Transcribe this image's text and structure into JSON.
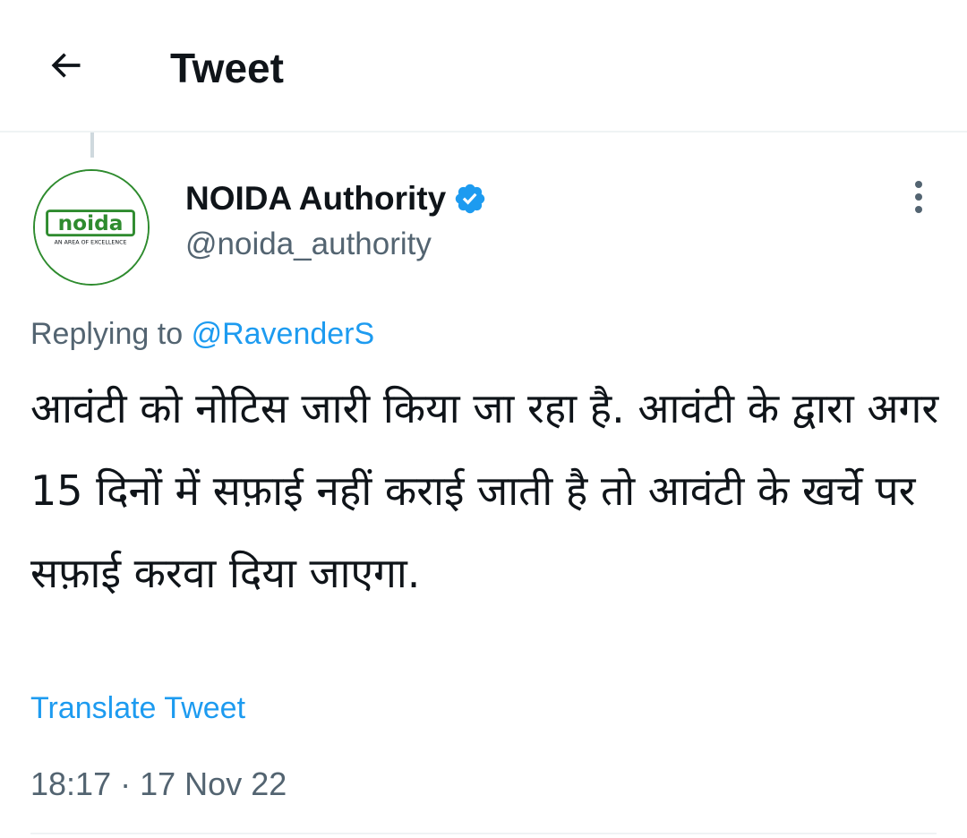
{
  "header": {
    "title": "Tweet",
    "back_icon": "arrow-left-icon"
  },
  "author": {
    "display_name": "NOIDA Authority",
    "handle": "@noida_authority",
    "verified": true,
    "verified_icon": "verified-badge-icon",
    "avatar": {
      "logo_text": "noida",
      "tagline": "AN AREA OF EXCELLENCE"
    }
  },
  "more_icon": "more-vertical-icon",
  "reply": {
    "prefix": "Replying to",
    "handle": "@RavenderS"
  },
  "tweet": {
    "text": "आवंटी को नोटिस जारी किया जा रहा है. आवंटी के द्वारा अगर 15 दिनों में सफ़ाई नहीं कराई जाती है तो आवंटी के खर्चे पर सफ़ाई करवा दिया जाएगा.",
    "translate_label": "Translate Tweet",
    "time": "18:17",
    "separator": "·",
    "date": "17 Nov 22"
  },
  "colors": {
    "accent": "#1d9bf0",
    "text_primary": "#0f1419",
    "text_secondary": "#536471",
    "divider": "#eff3f4",
    "logo_green": "#2e8b2e"
  }
}
